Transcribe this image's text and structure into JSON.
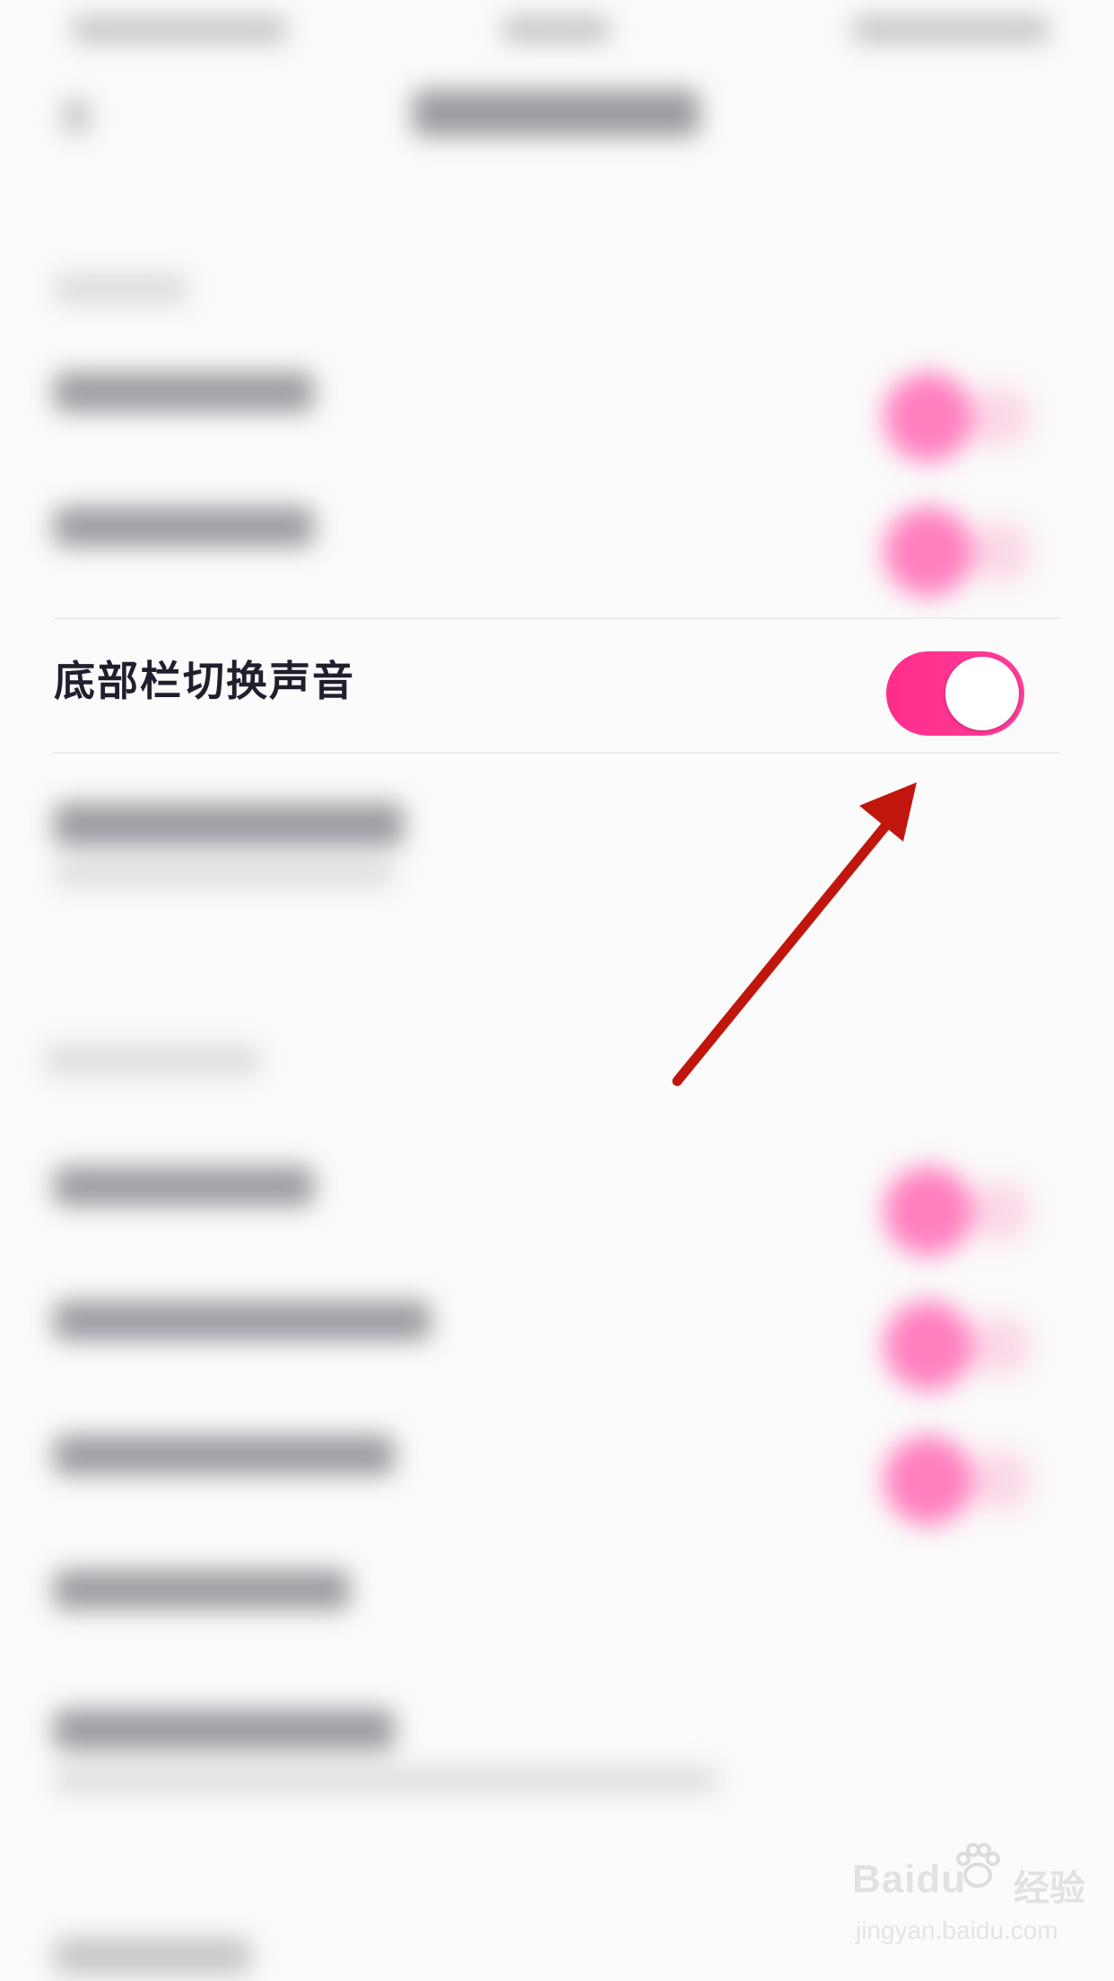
{
  "settings_row": {
    "label": "底部栏切换声音",
    "toggle_on": true
  },
  "colors": {
    "toggle_on": "#ff2d8c",
    "arrow": "#c0160e",
    "background": "#fbfbfb"
  },
  "annotation": {
    "icon": "arrow-icon"
  },
  "watermark": {
    "logo_text": "Baidu",
    "product": "经验",
    "url": "jingyan.baidu.com"
  }
}
